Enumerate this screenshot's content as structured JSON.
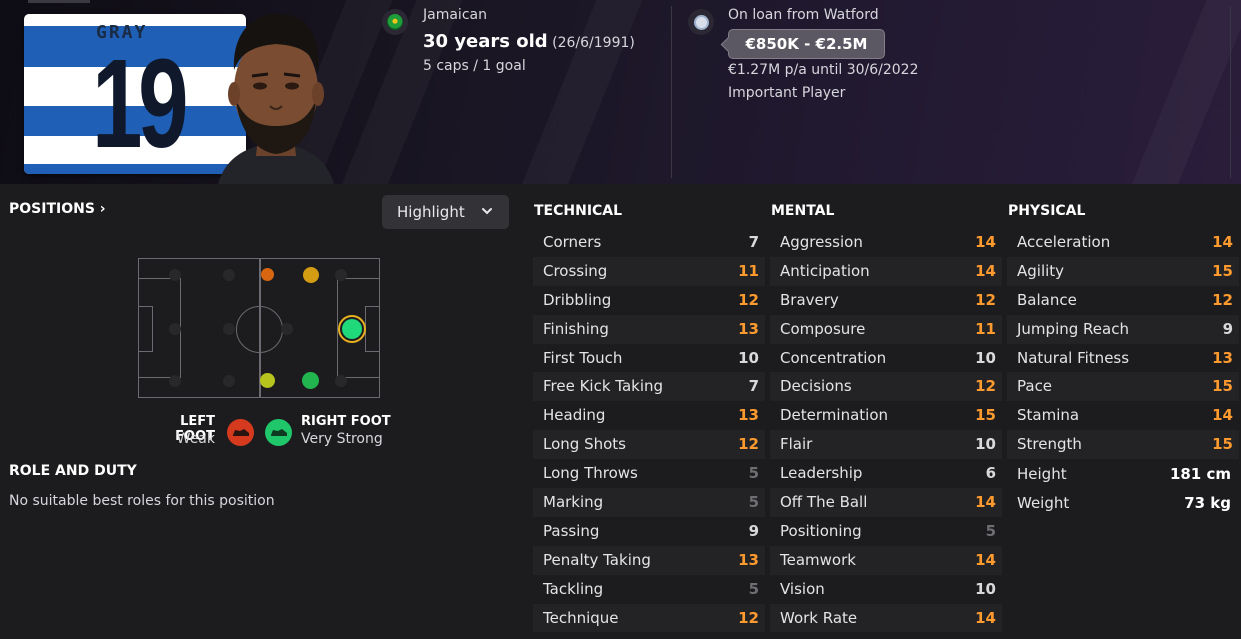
{
  "header": {
    "shirt": {
      "name": "GRAY",
      "number": "19"
    },
    "nationality": "Jamaican",
    "age": "30 years old",
    "dob": "(26/6/1991)",
    "caps": "5 caps / 1 goal",
    "loan": "On loan from Watford",
    "value": "€850K - €2.5M",
    "wage": "€1.27M p/a until 30/6/2022",
    "status": "Important Player"
  },
  "positions": {
    "link": "POSITIONS",
    "highlight_label": "Highlight",
    "dots": [
      {
        "role": "AML",
        "color": "#d8650f"
      },
      {
        "role": "AMR",
        "color": "#d39c12"
      },
      {
        "role": "ST",
        "color": "#1fd97a",
        "selected": true
      },
      {
        "role": "ML",
        "color": "#b7c41e"
      },
      {
        "role": "MR",
        "color": "#22b54f"
      }
    ]
  },
  "feet": {
    "left_label": "LEFT FOOT",
    "left_value": "Weak",
    "right_label": "RIGHT FOOT",
    "right_value": "Very Strong",
    "colors": {
      "left": "#d63a1e",
      "right": "#1fc76a"
    }
  },
  "role": {
    "title": "ROLE AND DUTY",
    "text": "No suitable best roles for this position"
  },
  "technical": {
    "title": "TECHNICAL",
    "attrs": [
      {
        "name": "Corners",
        "value": 7
      },
      {
        "name": "Crossing",
        "value": 11
      },
      {
        "name": "Dribbling",
        "value": 12
      },
      {
        "name": "Finishing",
        "value": 13
      },
      {
        "name": "First Touch",
        "value": 10
      },
      {
        "name": "Free Kick Taking",
        "value": 7
      },
      {
        "name": "Heading",
        "value": 13
      },
      {
        "name": "Long Shots",
        "value": 12
      },
      {
        "name": "Long Throws",
        "value": 5
      },
      {
        "name": "Marking",
        "value": 5
      },
      {
        "name": "Passing",
        "value": 9
      },
      {
        "name": "Penalty Taking",
        "value": 13
      },
      {
        "name": "Tackling",
        "value": 5
      },
      {
        "name": "Technique",
        "value": 12
      }
    ]
  },
  "mental": {
    "title": "MENTAL",
    "attrs": [
      {
        "name": "Aggression",
        "value": 14
      },
      {
        "name": "Anticipation",
        "value": 14
      },
      {
        "name": "Bravery",
        "value": 12
      },
      {
        "name": "Composure",
        "value": 11
      },
      {
        "name": "Concentration",
        "value": 10
      },
      {
        "name": "Decisions",
        "value": 12
      },
      {
        "name": "Determination",
        "value": 15
      },
      {
        "name": "Flair",
        "value": 10
      },
      {
        "name": "Leadership",
        "value": 6
      },
      {
        "name": "Off The Ball",
        "value": 14
      },
      {
        "name": "Positioning",
        "value": 5
      },
      {
        "name": "Teamwork",
        "value": 14
      },
      {
        "name": "Vision",
        "value": 10
      },
      {
        "name": "Work Rate",
        "value": 14
      }
    ]
  },
  "physical": {
    "title": "PHYSICAL",
    "attrs": [
      {
        "name": "Acceleration",
        "value": 14
      },
      {
        "name": "Agility",
        "value": 15
      },
      {
        "name": "Balance",
        "value": 12
      },
      {
        "name": "Jumping Reach",
        "value": 9
      },
      {
        "name": "Natural Fitness",
        "value": 13
      },
      {
        "name": "Pace",
        "value": 15
      },
      {
        "name": "Stamina",
        "value": 14
      },
      {
        "name": "Strength",
        "value": 15
      }
    ],
    "height_label": "Height",
    "height": "181 cm",
    "weight_label": "Weight",
    "weight": "73 kg"
  },
  "colors": {
    "good": "#ff9a2e",
    "mid": "#d9d9dc",
    "low": "#6e6e73"
  }
}
